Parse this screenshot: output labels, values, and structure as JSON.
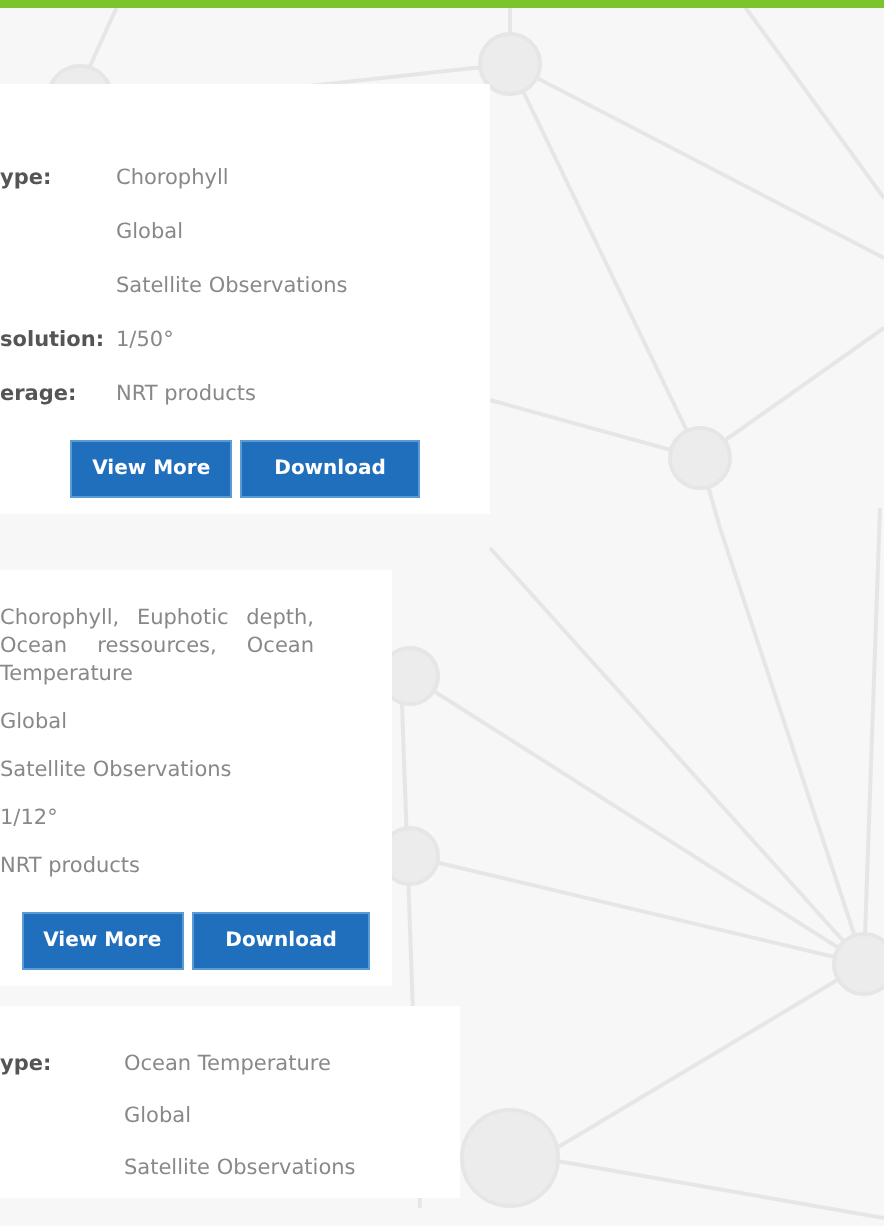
{
  "cards": [
    {
      "rows": [
        {
          "label": "ype:",
          "value": "Chorophyll"
        },
        {
          "value": "Global"
        },
        {
          "value": "Satellite Observations"
        },
        {
          "label": "solution:",
          "value": "1/50°"
        },
        {
          "label": "erage:",
          "value": "NRT products"
        }
      ],
      "buttons": [
        "View More",
        "Download"
      ]
    },
    {
      "rows": [
        {
          "value": "Chorophyll, Euphotic depth, Ocean ressources, Ocean Temperature"
        },
        {
          "value": "Global"
        },
        {
          "value": "Satellite Observations"
        },
        {
          "value": "1/12°"
        },
        {
          "value": "NRT products"
        }
      ],
      "buttons": [
        "View More",
        "Download"
      ]
    },
    {
      "rows": [
        {
          "label": "ype:",
          "value": "Ocean Temperature"
        },
        {
          "value": "Global"
        },
        {
          "value": "Satellite Observations"
        }
      ]
    }
  ]
}
